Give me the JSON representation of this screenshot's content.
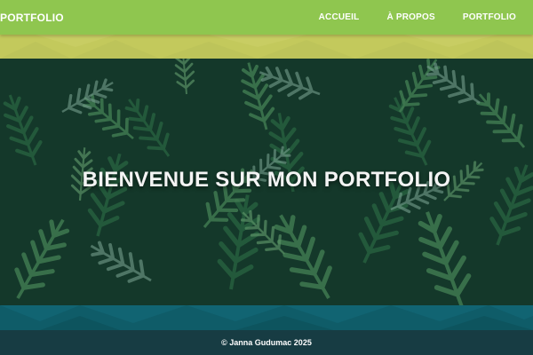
{
  "header": {
    "brand": "PORTFOLIO",
    "nav": [
      {
        "label": "ACCUEIL"
      },
      {
        "label": "À PROPOS"
      },
      {
        "label": "PORTFOLIO"
      }
    ]
  },
  "hero": {
    "title": "BIENVENUE SUR MON PORTFOLIO",
    "background": "evergreen-foliage-photo"
  },
  "footer": {
    "copyright": "© Janna Gudumac 2025"
  },
  "colors": {
    "header_bg": "#8fc64f",
    "top_strip": "#c3c95c",
    "bottom_strip": "#0f5c68",
    "footer_bg": "#173c43",
    "text": "#ffffff"
  }
}
